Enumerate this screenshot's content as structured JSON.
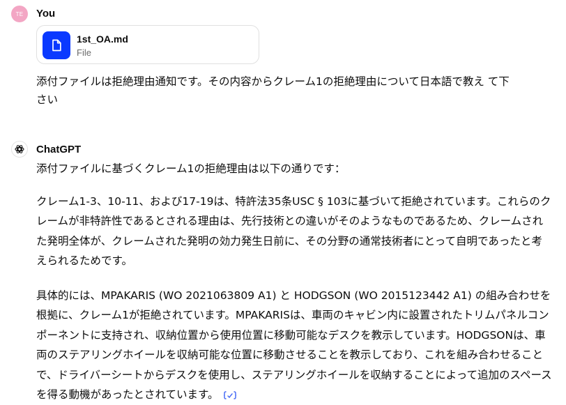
{
  "user": {
    "avatar_initials": "TE",
    "name": "You",
    "attachment": {
      "file_name": "1st_OA.md",
      "file_type": "File",
      "icon": "document-icon",
      "icon_color": "#0a39ff"
    },
    "message": "添付ファイルは拒絶理由通知です。その内容からクレーム1の拒絶理由について日本語で教え て下さい"
  },
  "assistant": {
    "name": "ChatGPT",
    "avatar_icon": "openai-logo-icon",
    "intro": "添付ファイルに基づくクレーム1の拒絶理由は以下の通りです：",
    "paragraph1": "クレーム1-3、10-11、および17-19は、特許法35条USC § 103に基づいて拒絶されています。これらのクレームが非特許性であるとされる理由は、先行技術との違いがそのようなものであるため、クレームされた発明全体が、クレームされた発明の効力発生日前に、その分野の通常技術者にとって自明であったと考えられるためです。",
    "paragraph2": "具体的には、MPAKARIS (WO 2021063809 A1) と HODGSON (WO 2015123442 A1) の組み合わせを根拠に、クレーム1が拒絶されています。MPAKARISは、車両のキャビン内に設置されたトリムパネルコンポーネントに支持され、収納位置から使用位置に移動可能なデスクを教示しています。HODGSONは、車両のステアリングホイールを収納可能な位置に移動させることを教示しており、これを組み合わせることで、ドライバーシートからデスクを使用し、ステアリングホイールを収納することによって追加のスペースを得る動機があったとされています。",
    "citation_icon": "citation-icon",
    "citation_color": "#4b6ef5"
  }
}
